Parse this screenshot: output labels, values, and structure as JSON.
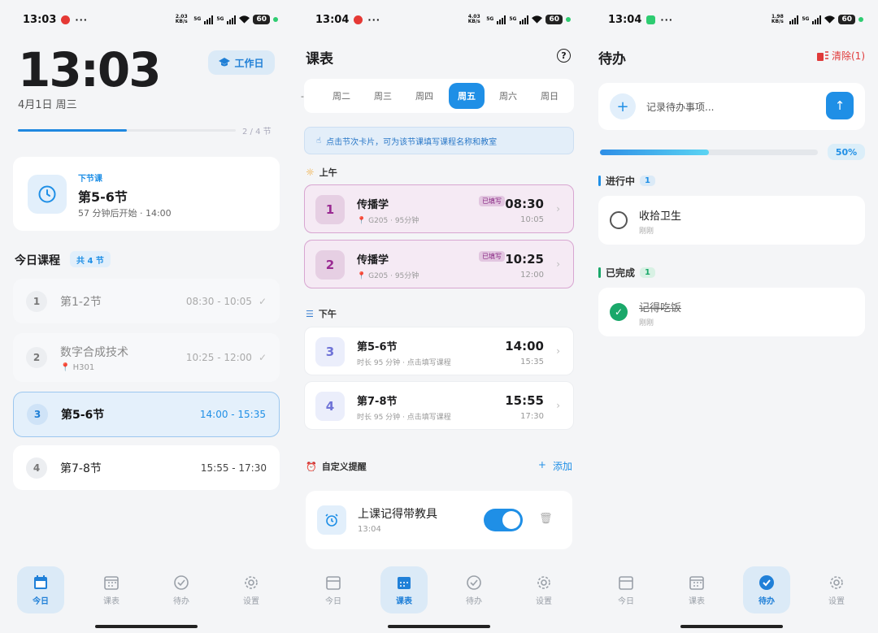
{
  "status": [
    {
      "time": "13:03",
      "speed": "2.03 KB/s",
      "battery": "60",
      "app_color": "#e53935"
    },
    {
      "time": "13:04",
      "speed": "4.03 KB/s",
      "battery": "60",
      "app_color": "#e53935"
    },
    {
      "time": "13:04",
      "speed": "1.98 KB/s",
      "battery": "60",
      "app_color": "#2ecc71"
    }
  ],
  "nav": {
    "today": "今日",
    "schedule": "课表",
    "todo": "待办",
    "settings": "设置"
  },
  "today": {
    "clock": "13:03",
    "date": "4月1日  周三",
    "workday": "工作日",
    "progress_text": "2 / 4 节",
    "progress": 0.5,
    "next": {
      "label": "下节课",
      "title": "第5-6节",
      "sub": "57 分钟后开始 · 14:00"
    },
    "section_title": "今日课程",
    "count_badge": "共 4 节",
    "lessons": [
      {
        "num": "1",
        "title": "第1-2节",
        "time": "08:30 - 10:05",
        "room": ""
      },
      {
        "num": "2",
        "title": "数字合成技术",
        "time": "10:25 - 12:00",
        "room": "H301"
      },
      {
        "num": "3",
        "title": "第5-6节",
        "time": "14:00 - 15:35",
        "room": ""
      },
      {
        "num": "4",
        "title": "第7-8节",
        "time": "15:55 - 17:30",
        "room": ""
      }
    ]
  },
  "schedule": {
    "title": "课表",
    "days": [
      "-",
      "周二",
      "周三",
      "周四",
      "周五",
      "周六",
      "周日"
    ],
    "tip": "点击节次卡片，可为该节课填写课程名称和教室",
    "morning": "上午",
    "afternoon": "下午",
    "filled_tag": "已填写",
    "slots": [
      {
        "num": "1",
        "name": "传播学",
        "sub": "G205  ·  95分钟",
        "start": "08:30",
        "end": "10:05"
      },
      {
        "num": "2",
        "name": "传播学",
        "sub": "G205  ·  95分钟",
        "start": "10:25",
        "end": "12:00"
      },
      {
        "num": "3",
        "name": "第5-6节",
        "sub": "时长 95 分钟  ·  点击填写课程",
        "start": "14:00",
        "end": "15:35"
      },
      {
        "num": "4",
        "name": "第7-8节",
        "sub": "时长 95 分钟  ·  点击填写课程",
        "start": "15:55",
        "end": "17:30"
      }
    ],
    "custom_title": "自定义提醒",
    "add": "添加",
    "reminder": {
      "title": "上课记得带教具",
      "time": "13:04",
      "enabled": true
    }
  },
  "todo": {
    "title": "待办",
    "clear": "清除(1)",
    "placeholder": "记录待办事项...",
    "progress": 0.5,
    "progress_text": "50%",
    "in_progress": "进行中",
    "in_progress_count": "1",
    "done": "已完成",
    "done_count": "1",
    "items_open": [
      {
        "title": "收拾卫生",
        "sub": "刚刚"
      }
    ],
    "items_done": [
      {
        "title": "记得吃饭",
        "sub": "刚刚"
      }
    ]
  }
}
